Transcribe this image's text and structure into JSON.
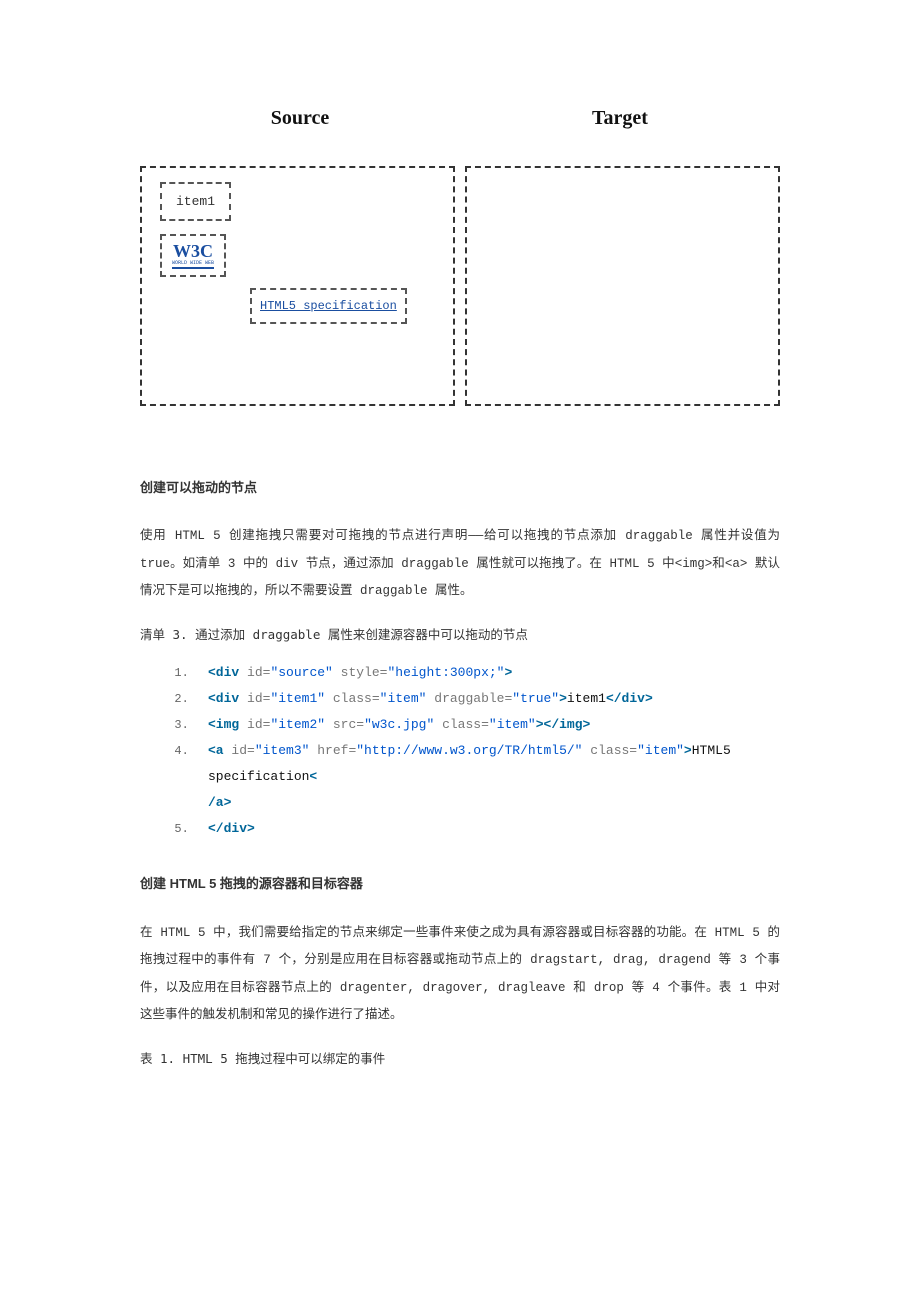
{
  "figure": {
    "source_label": "Source",
    "target_label": "Target",
    "item1": "item1",
    "w3c_main": "W3C",
    "w3c_sub": "WORLD WIDE WEB",
    "item3_text": "HTML5 specification"
  },
  "section1": {
    "title": "创建可以拖动的节点",
    "paragraph": "使用 HTML 5 创建拖拽只需要对可拖拽的节点进行声明——给可以拖拽的节点添加 draggable 属性并设值为 true。如清单 3 中的 div 节点，通过添加 draggable 属性就可以拖拽了。在 HTML 5 中<img>和<a> 默认情况下是可以拖拽的，所以不需要设置 draggable 属性。",
    "listing_title": "清单 3. 通过添加 draggable 属性来创建源容器中可以拖动的节点"
  },
  "code": {
    "l1": {
      "open": "<div",
      "a1": " id=",
      "v1": "\"source\"",
      "a2": " style=",
      "v2": "\"height:300px;\"",
      "close": ">"
    },
    "l2": {
      "indent": "  ",
      "open": "<div",
      "a1": " id=",
      "v1": "\"item1\"",
      "a2": " class=",
      "v2": "\"item\"",
      "a3": " draggable=",
      "v3": "\"true\"",
      "close": ">",
      "text": "item1",
      "end": "</div>"
    },
    "l3": {
      "indent": "  ",
      "open": "<img",
      "a1": " id=",
      "v1": "\"item2\"",
      "a2": " src=",
      "v2": "\"w3c.jpg\"",
      "a3": " class=",
      "v3": "\"item\"",
      "close": ">",
      "end": "</img>"
    },
    "l4": {
      "indent": "  ",
      "open": "<a",
      "a1": " id=",
      "v1": "\"item3\"",
      "a2": " href=",
      "v2": "\"http://www.w3.org/TR/html5/\"",
      "a3": " class=",
      "v3": "\"item\"",
      "close": ">",
      "text": "HTML5 specification",
      "end_open": "<",
      "end_rest": "/a>"
    },
    "l5": {
      "indent": "  ",
      "end": "</div>"
    }
  },
  "section2": {
    "title": "创建 HTML 5 拖拽的源容器和目标容器",
    "paragraph": "在 HTML 5 中，我们需要给指定的节点来绑定一些事件来使之成为具有源容器或目标容器的功能。在 HTML 5 的拖拽过程中的事件有 7 个，分别是应用在目标容器或拖动节点上的 dragstart, drag, dragend 等 3 个事件，以及应用在目标容器节点上的 dragenter, dragover, dragleave 和 drop 等 4 个事件。表 1 中对这些事件的触发机制和常见的操作进行了描述。",
    "table_title": "表 1. HTML 5 拖拽过程中可以绑定的事件"
  }
}
